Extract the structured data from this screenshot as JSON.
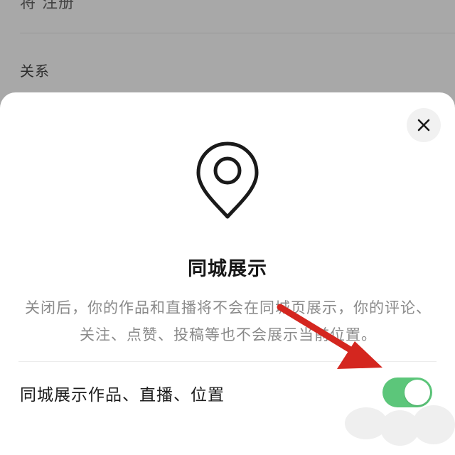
{
  "background": {
    "top_row_text": "将 注册",
    "section_label": "关系"
  },
  "sheet": {
    "close_icon": "close-icon",
    "location_icon": "location-pin-icon",
    "title": "同城展示",
    "description": "关闭后，你的作品和直播将不会在同城页展示，你的评论、关注、点赞、投稿等也不会展示当前位置。",
    "setting": {
      "label": "同城展示作品、直播、位置",
      "enabled": true
    }
  },
  "colors": {
    "toggle_on": "#5cc67a",
    "arrow": "#d4261f",
    "overlay": "#a8a8a8"
  }
}
